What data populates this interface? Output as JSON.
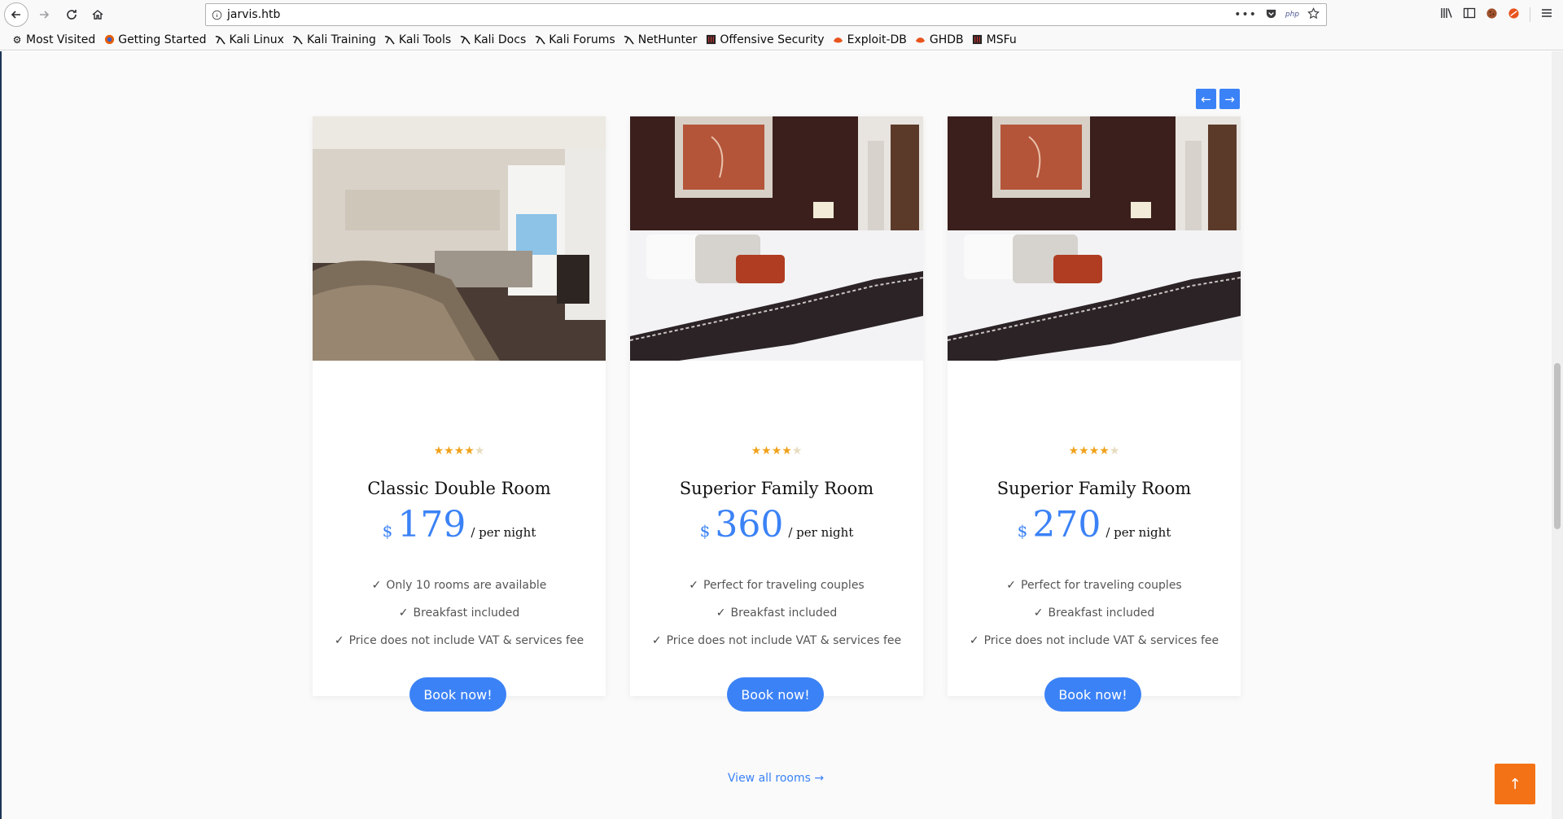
{
  "browser": {
    "url": "jarvis.htb",
    "php_badge": "php",
    "bookmarks": [
      {
        "label": "Most Visited",
        "icon": "gear-icon"
      },
      {
        "label": "Getting Started",
        "icon": "firefox-icon"
      },
      {
        "label": "Kali Linux",
        "icon": "kali-icon"
      },
      {
        "label": "Kali Training",
        "icon": "kali-icon"
      },
      {
        "label": "Kali Tools",
        "icon": "kali-icon"
      },
      {
        "label": "Kali Docs",
        "icon": "kali-icon"
      },
      {
        "label": "Kali Forums",
        "icon": "kali-icon"
      },
      {
        "label": "NetHunter",
        "icon": "kali-icon"
      },
      {
        "label": "Offensive Security",
        "icon": "offsec-icon"
      },
      {
        "label": "Exploit-DB",
        "icon": "exploitdb-icon"
      },
      {
        "label": "GHDB",
        "icon": "exploitdb-icon"
      },
      {
        "label": "MSFu",
        "icon": "offsec-icon"
      }
    ]
  },
  "carousel": {
    "prev_label": "←",
    "next_label": "→"
  },
  "rooms": [
    {
      "title": "Classic Double Room",
      "currency": "$",
      "price": "179",
      "unit": "/ per night",
      "rating": 4,
      "rating_max": 5,
      "image": "bright bedroom with balcony",
      "features": [
        "Only 10 rooms are available",
        "Breakfast included",
        "Price does not include VAT & services fee"
      ],
      "button": "Book now!"
    },
    {
      "title": "Superior Family Room",
      "currency": "$",
      "price": "360",
      "unit": "/ per night",
      "rating": 4,
      "rating_max": 5,
      "image": "dark bedroom with patterned throw",
      "features": [
        "Perfect for traveling couples",
        "Breakfast included",
        "Price does not include VAT & services fee"
      ],
      "button": "Book now!"
    },
    {
      "title": "Superior Family Room",
      "currency": "$",
      "price": "270",
      "unit": "/ per night",
      "rating": 4,
      "rating_max": 5,
      "image": "dark bedroom with patterned throw",
      "features": [
        "Perfect for traveling couples",
        "Breakfast included",
        "Price does not include VAT & services fee"
      ],
      "button": "Book now!"
    }
  ],
  "footer": {
    "view_all": "View all rooms →",
    "to_top": "↑"
  },
  "colors": {
    "accent": "#3b82f6",
    "star": "#f0a21b",
    "to_top": "#f47216"
  }
}
